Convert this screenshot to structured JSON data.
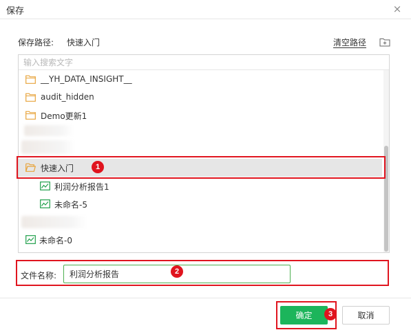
{
  "dialog": {
    "title": "保存",
    "close_glyph": "×"
  },
  "path": {
    "label": "保存路径:",
    "value": "快速入门",
    "clear_label": "清空路径",
    "new_folder_icon": "folder-plus-icon"
  },
  "tree": {
    "search_placeholder": "输入搜索文字",
    "items": [
      {
        "label": "__YH_DATA_INSIGHT__",
        "icon": "folder-icon"
      },
      {
        "label": "audit_hidden",
        "icon": "folder-icon"
      },
      {
        "label": "Demo更新1",
        "icon": "folder-icon"
      },
      {
        "label": "快速入门",
        "icon": "folder-open-icon",
        "selected": true
      },
      {
        "label": "利润分析报告1",
        "icon": "report-chart-icon"
      },
      {
        "label": "未命名-5",
        "icon": "report-chart-icon"
      },
      {
        "label": "未命名-0",
        "icon": "report-chart-icon"
      }
    ]
  },
  "filename": {
    "label": "文件名称:",
    "value": "利润分析报告"
  },
  "buttons": {
    "ok": "确定",
    "cancel": "取消"
  },
  "annotations": [
    "1",
    "2",
    "3"
  ],
  "colors": {
    "folder": "#e8a33a",
    "report_icon": "#1e9f4a",
    "primary": "#1cb55b",
    "highlight": "#e0141e",
    "selected_row": "#e6e6e6"
  }
}
